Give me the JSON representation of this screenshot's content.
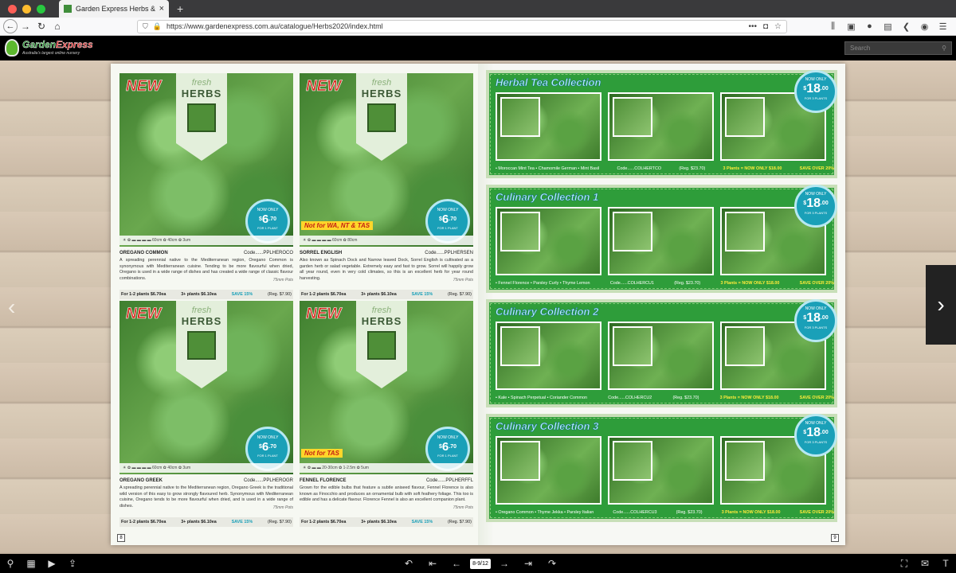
{
  "browser": {
    "tab_title": "Garden Express Herbs & Comp",
    "tab_close": "×",
    "new_tab": "+",
    "url": "https://www.gardenexpress.com.au/catalogue/Herbs2020/index.html",
    "url_more": "•••"
  },
  "site": {
    "logo_word1": "Garden",
    "logo_word2": "Express",
    "logo_tagline": "Australia's largest online nursery",
    "search_placeholder": "Search"
  },
  "left_page": {
    "page_number": "8",
    "products": [
      {
        "name": "OREGANO COMMON",
        "code": "Code......PPLHEROCO",
        "badge": "NEW",
        "banner_fresh": "fresh",
        "banner_title": "HERBS",
        "price_now": "NOW ONLY",
        "price_dollar": "$",
        "price_main": "6",
        "price_cents": ".70",
        "price_for": "FOR 1 PLANT",
        "restriction": "",
        "icons": "☀ ✿ ▬ ▬ ▬ ▬  60cm  ✿ 40cm  ✿ 3um",
        "desc": "A spreading perennial native to the Mediterranean region, Oregano Common is synonymous with Mediterranean cuisine. Tending to be more flavourful when dried, Oregano is used in a wide range of dishes and has created a wide range of classic flavour combinations.",
        "pots": "75mm Pots",
        "p12": "For 1-2 plants $6.70ea",
        "p3": "3+ plants $6.10ea",
        "save": "SAVE 15%",
        "reg": "(Reg. $7.90)"
      },
      {
        "name": "SORREL ENGLISH",
        "code": "Code......PPLHERSEN",
        "badge": "NEW",
        "banner_fresh": "fresh",
        "banner_title": "HERBS",
        "price_now": "NOW ONLY",
        "price_dollar": "$",
        "price_main": "6",
        "price_cents": ".70",
        "price_for": "FOR 1 PLANT",
        "restriction": "Not for WA, NT & TAS",
        "icons": "☀ ✿ ▬ ▬ ▬ ▬  60cm  ✿ 80cm",
        "desc": "Also known as Spinach Dock and Narrow leaved Dock, Sorrel English is cultivated as a garden herb or salad vegetable. Extremely easy and fast to grow. Sorrel will happily grow all year round, even in very cold climates, so this is an excellent herb for year round harvesting.",
        "pots": "75mm Pots",
        "p12": "For 1-2 plants $6.70ea",
        "p3": "3+ plants $6.10ea",
        "save": "SAVE 15%",
        "reg": "(Reg. $7.90)"
      },
      {
        "name": "OREGANO GREEK",
        "code": "Code......PPLHEROGR",
        "badge": "NEW",
        "banner_fresh": "fresh",
        "banner_title": "HERBS",
        "price_now": "NOW ONLY",
        "price_dollar": "$",
        "price_main": "6",
        "price_cents": ".70",
        "price_for": "FOR 1 PLANT",
        "restriction": "",
        "icons": "☀ ✿ ▬ ▬ ▬ ▬  60cm  ✿ 40cm  ✿ 3um",
        "desc": "A spreading perennial native to the Mediterranean region, Oregano Greek is the traditional wild version of this easy to grow strongly flavoured herb. Synonymous with Mediterranean cuisine, Oregano tends to be more flavourful when dried, and is used in a wide range of dishes.",
        "pots": "75mm Pots",
        "p12": "For 1-2 plants $6.70ea",
        "p3": "3+ plants $6.10ea",
        "save": "SAVE 15%",
        "reg": "(Reg. $7.90)"
      },
      {
        "name": "FENNEL FLORENCE",
        "code": "Code......PPLHERFFL",
        "badge": "NEW",
        "banner_fresh": "fresh",
        "banner_title": "HERBS",
        "price_now": "NOW ONLY",
        "price_dollar": "$",
        "price_main": "6",
        "price_cents": ".70",
        "price_for": "FOR 1 PLANT",
        "restriction": "Not for TAS",
        "icons": "☀ ✿ ▬ ▬  20-30cm  ✿ 1-2.5m  ✿ 5um",
        "desc": "Grown for the edible bulbs that feature a subtle aniseed flavour, Fennel Florence is also known as Finocchio and produces an ornamental bulb with soft feathery foliage. This too is edible and has a delicate flavour. Florence Fennel is also an excellent companion plant.",
        "pots": "75mm Pots",
        "p12": "For 1-2 plants $6.70ea",
        "p3": "3+ plants $6.10ea",
        "save": "SAVE 15%",
        "reg": "(Reg. $7.90)"
      }
    ]
  },
  "right_page": {
    "page_number": "9",
    "collections": [
      {
        "title": "Herbal Tea Collection",
        "contents": "• Moroccan Mint Tea • Chamomile German • Mint Basil",
        "code": "Code......COLHERTCO",
        "reg": "(Reg. $23.70)",
        "deal": "3 Plants = NOW ONLY $18.00",
        "save": "SAVE OVER 20%",
        "price_now": "NOW ONLY",
        "price_dollar": "$",
        "price_main": "18",
        "price_cents": ".00",
        "price_for": "FOR 3 PLANTS"
      },
      {
        "title": "Culinary Collection 1",
        "contents": "• Fennel Florence • Parsley Curly • Thyme Lemon",
        "code": "Code......COLHERCU1",
        "reg": "(Reg. $23.70)",
        "deal": "3 Plants = NOW ONLY $18.00",
        "save": "SAVE OVER 20%",
        "price_now": "NOW ONLY",
        "price_dollar": "$",
        "price_main": "18",
        "price_cents": ".00",
        "price_for": "FOR 3 PLANTS"
      },
      {
        "title": "Culinary Collection 2",
        "contents": "• Kale • Spinach Perpetual • Coriander Common",
        "code": "Code......COLHERCU2",
        "reg": "(Reg. $23.70)",
        "deal": "3 Plants = NOW ONLY $18.00",
        "save": "SAVE OVER 20%",
        "price_now": "NOW ONLY",
        "price_dollar": "$",
        "price_main": "18",
        "price_cents": ".00",
        "price_for": "FOR 3 PLANTS"
      },
      {
        "title": "Culinary Collection 3",
        "contents": "• Oregano Common • Thyme Jekka • Parsley Italian",
        "code": "Code......COLHERCU3",
        "reg": "(Reg. $23.70)",
        "deal": "3 Plants = NOW ONLY $18.00",
        "save": "SAVE OVER 20%",
        "price_now": "NOW ONLY",
        "price_dollar": "$",
        "price_main": "18",
        "price_cents": ".00",
        "price_for": "FOR 3 PLANTS"
      }
    ]
  },
  "viewer": {
    "page_indicator": "8-9/12",
    "icons": [
      "zoom-icon",
      "grid-icon",
      "play-icon",
      "share-icon",
      "undo-icon",
      "first-page-icon",
      "prev-page-icon",
      "next-page-icon",
      "last-page-icon",
      "redo-icon",
      "fullscreen-icon",
      "email-icon",
      "text-icon"
    ]
  }
}
